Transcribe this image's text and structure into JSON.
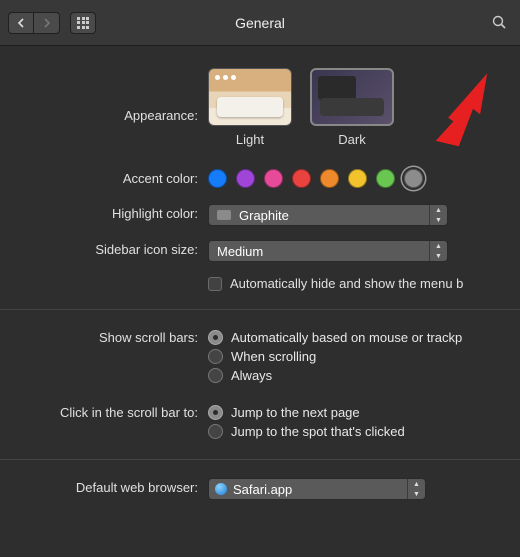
{
  "window": {
    "title": "General"
  },
  "appearance": {
    "label": "Appearance:",
    "options": [
      {
        "label": "Light"
      },
      {
        "label": "Dark"
      }
    ],
    "selected": "Dark"
  },
  "accent": {
    "label": "Accent color:",
    "colors": [
      "#157df9",
      "#9f45d8",
      "#e84a9a",
      "#e8433f",
      "#ef8a2c",
      "#f3c32e",
      "#68c651",
      "#8c8c8c"
    ],
    "selected_index": 7
  },
  "highlight": {
    "label": "Highlight color:",
    "value": "Graphite"
  },
  "sidebar_size": {
    "label": "Sidebar icon size:",
    "value": "Medium"
  },
  "menubar_autohide": {
    "label": "Automatically hide and show the menu b",
    "checked": false
  },
  "scrollbars": {
    "label": "Show scroll bars:",
    "options": [
      "Automatically based on mouse or trackp",
      "When scrolling",
      "Always"
    ],
    "selected_index": 0
  },
  "scrollbar_click": {
    "label": "Click in the scroll bar to:",
    "options": [
      "Jump to the next page",
      "Jump to the spot that's clicked"
    ],
    "selected_index": 0
  },
  "browser": {
    "label": "Default web browser:",
    "value": "Safari.app"
  }
}
